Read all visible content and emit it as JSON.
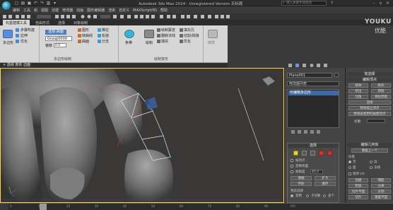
{
  "window": {
    "title": "Autodesk 3ds Max  2014   - Unregistered Version  无标题",
    "search_placeholder": "键入关键字或短语"
  },
  "menu": {
    "items": [
      "编辑",
      "工具",
      "组",
      "视图",
      "创建",
      "修改器",
      "动画",
      "图形编辑器",
      "渲染",
      "自定义",
      "MAXScript(M)",
      "帮助"
    ]
  },
  "ribbon": {
    "tabs": [
      "石墨建模工具",
      "自由形式",
      "选择",
      "对象绘制"
    ],
    "active_tab": "石墨建模工具",
    "group_polygon": {
      "main_button": "多边形",
      "items": [
        "步骤构建",
        "拉伸",
        "优化"
      ]
    },
    "group_brush": {
      "field_label": "选择:曲面",
      "field_value": "Group0000",
      "offset_label": "偏移",
      "offset_value": "0.0",
      "items": [
        "图形",
        "转曲线",
        "曲面",
        "推拉",
        "松弛",
        "分支"
      ]
    },
    "group_draw": {
      "main_button": "条带",
      "items": [
        "绘制",
        "绘制蒙皮",
        "翻转法线",
        "填充",
        "填充孔",
        "切割/焊接",
        "优化",
        "收缩/扩散",
        "曲面画",
        "选择"
      ]
    },
    "group_ops": {
      "items": [
        "修改",
        "选择/更新",
        "接缝"
      ]
    },
    "panel_label": "多边形绘制",
    "panel_label2": "绘制变形"
  },
  "viewport": {
    "label_prefix": "+",
    "label_view": "透视",
    "label_shading": "真实",
    "label_extra": "边面",
    "border_color": "#ffd54a"
  },
  "command_panel": {
    "object_name": "Plane001",
    "modifier_list": "修改器列表",
    "stack_item": "可编辑多边形",
    "selection_title": "选择",
    "by_vertex": "按顶点",
    "ignore_backface": "忽略背面",
    "by_angle": "按角度",
    "angle_value": "45.0",
    "shrink": "收缩",
    "grow": "扩大",
    "ring": "环形",
    "loop": "循环",
    "preview_title": "预览选择",
    "preview_off": "禁用",
    "preview_subobj": "子对象",
    "preview_multi": "多个"
  },
  "edit_panel": {
    "soft_selection": "软选择",
    "edit_vertices": "编辑顶点",
    "remove": "移除",
    "break": "断开",
    "extrude": "挤出",
    "weld": "焊接",
    "chamfer": "切角",
    "target_weld": "目标焊接",
    "connect": "连接",
    "remove_isolated": "移除孤立顶点",
    "remove_unused": "移除未使用的贴图顶点",
    "weight_label": "权重:",
    "edit_geometry": "编辑几何体",
    "repeat_last": "重复上一个",
    "constraints": "约束",
    "none": "无",
    "edge": "边",
    "face": "面",
    "normal": "法线",
    "preserve_uv": "保持 UV",
    "create": "创建",
    "collapse": "塌陷",
    "attach": "附加",
    "detach": "分离",
    "slice_plane": "切片平面",
    "slice": "切片",
    "split": "分割",
    "reset_plane": "重置平面"
  },
  "watermark": {
    "line1": "YOUKU",
    "line2": "优酷"
  },
  "timeline": {
    "ticks": [
      "0",
      "10",
      "20",
      "30",
      "40",
      "50",
      "60",
      "70",
      "80",
      "90",
      "100"
    ]
  }
}
